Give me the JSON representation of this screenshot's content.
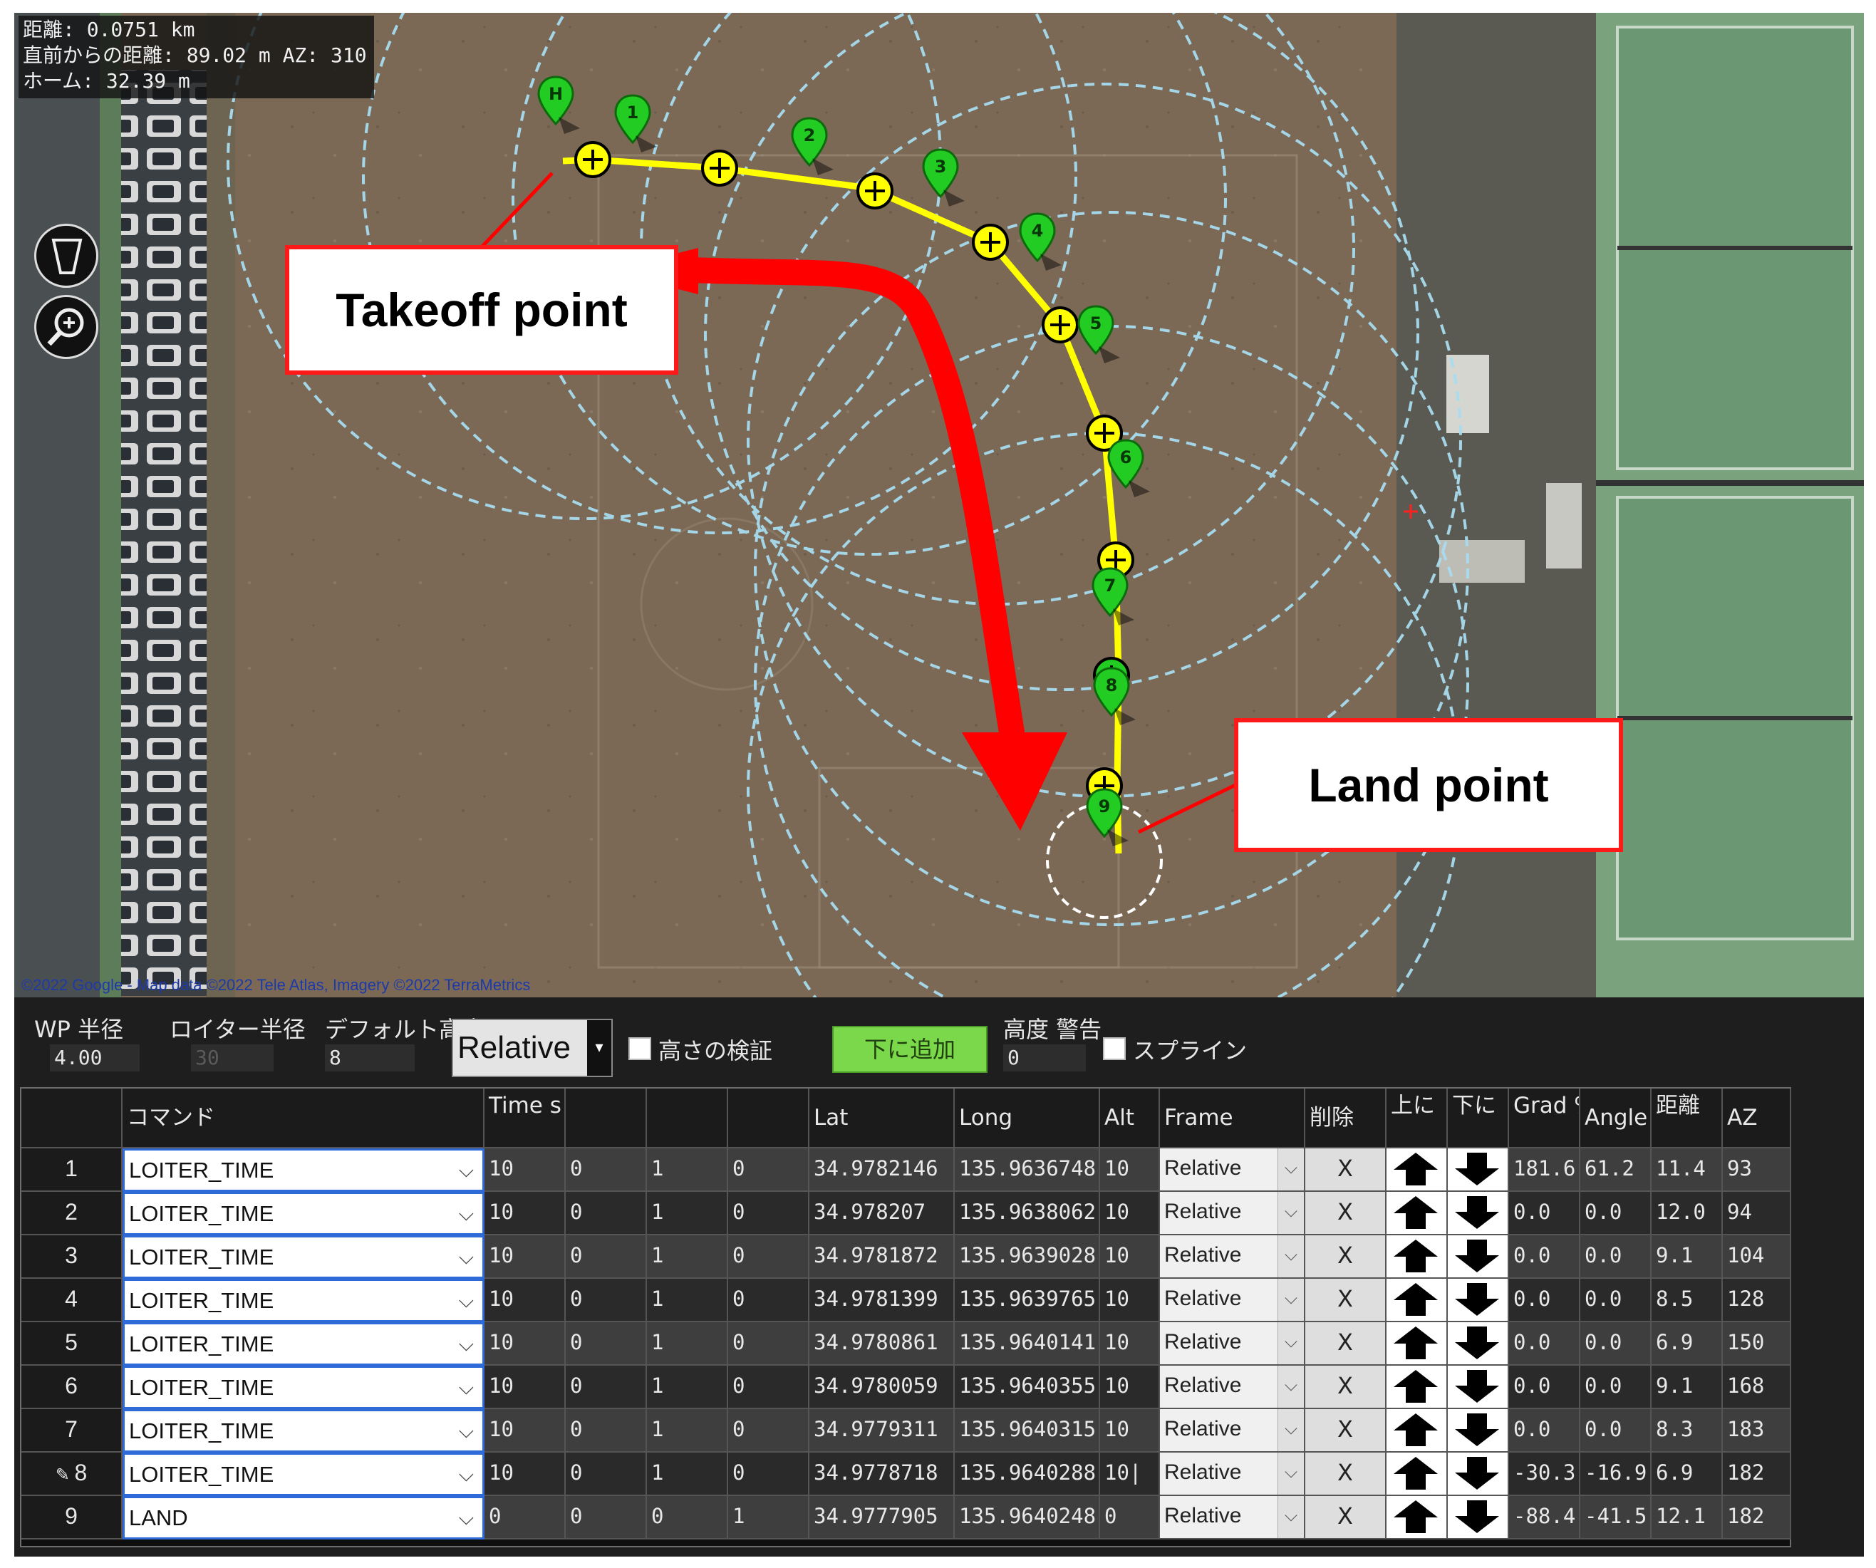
{
  "map": {
    "info": {
      "distance": "距離: 0.0751 km",
      "from_prev": "直前からの距離: 89.02 m AZ: 310",
      "home": "ホーム: 32.39 m"
    },
    "attribution": "©2022 Google - Map data ©2022 Tele Atlas, Imagery ©2022 TerraMetrics",
    "markers": [
      "H",
      "1",
      "2",
      "3",
      "4",
      "5",
      "6",
      "7",
      "8",
      "9"
    ],
    "tools": [
      "ruler-icon",
      "zoom-icon"
    ]
  },
  "callouts": {
    "takeoff": "Takeoff point",
    "land": "Land point"
  },
  "controls": {
    "wp_radius_label": "WP 半径",
    "wp_radius_value": "4.00",
    "loiter_radius_label": "ロイター半径",
    "loiter_radius_value": "30",
    "default_alt_label": "デフォルト高度",
    "default_alt_value": "8",
    "alt_frame_value": "Relative",
    "verify_height_label": "高さの検証",
    "add_below_label": "下に追加",
    "alt_warn_label": "高度 警告",
    "alt_warn_value": "0",
    "spline_label": "スプライン"
  },
  "table": {
    "headers": {
      "command": "コマンド",
      "time": "Time s",
      "p2": "",
      "p3": "",
      "p4": "",
      "lat": "Lat",
      "long": "Long",
      "alt": "Alt",
      "frame": "Frame",
      "delete": "削除",
      "up": "上に",
      "down": "下に",
      "grad": "Grad %",
      "angle": "Angle",
      "dist": "距離",
      "az": "AZ"
    },
    "rows": [
      {
        "n": "1",
        "cmd": "LOITER_TIME",
        "time": "10",
        "p2": "0",
        "p3": "1",
        "p4": "0",
        "lat": "34.9782146",
        "lon": "135.9636748",
        "alt": "10",
        "frame": "Relative",
        "del": "X",
        "grad": "181.6",
        "angle": "61.2",
        "dist": "11.4",
        "az": "93"
      },
      {
        "n": "2",
        "cmd": "LOITER_TIME",
        "time": "10",
        "p2": "0",
        "p3": "1",
        "p4": "0",
        "lat": "34.978207",
        "lon": "135.9638062",
        "alt": "10",
        "frame": "Relative",
        "del": "X",
        "grad": "0.0",
        "angle": "0.0",
        "dist": "12.0",
        "az": "94"
      },
      {
        "n": "3",
        "cmd": "LOITER_TIME",
        "time": "10",
        "p2": "0",
        "p3": "1",
        "p4": "0",
        "lat": "34.9781872",
        "lon": "135.9639028",
        "alt": "10",
        "frame": "Relative",
        "del": "X",
        "grad": "0.0",
        "angle": "0.0",
        "dist": "9.1",
        "az": "104"
      },
      {
        "n": "4",
        "cmd": "LOITER_TIME",
        "time": "10",
        "p2": "0",
        "p3": "1",
        "p4": "0",
        "lat": "34.9781399",
        "lon": "135.9639765",
        "alt": "10",
        "frame": "Relative",
        "del": "X",
        "grad": "0.0",
        "angle": "0.0",
        "dist": "8.5",
        "az": "128"
      },
      {
        "n": "5",
        "cmd": "LOITER_TIME",
        "time": "10",
        "p2": "0",
        "p3": "1",
        "p4": "0",
        "lat": "34.9780861",
        "lon": "135.9640141",
        "alt": "10",
        "frame": "Relative",
        "del": "X",
        "grad": "0.0",
        "angle": "0.0",
        "dist": "6.9",
        "az": "150"
      },
      {
        "n": "6",
        "cmd": "LOITER_TIME",
        "time": "10",
        "p2": "0",
        "p3": "1",
        "p4": "0",
        "lat": "34.9780059",
        "lon": "135.9640355",
        "alt": "10",
        "frame": "Relative",
        "del": "X",
        "grad": "0.0",
        "angle": "0.0",
        "dist": "9.1",
        "az": "168"
      },
      {
        "n": "7",
        "cmd": "LOITER_TIME",
        "time": "10",
        "p2": "0",
        "p3": "1",
        "p4": "0",
        "lat": "34.9779311",
        "lon": "135.9640315",
        "alt": "10",
        "frame": "Relative",
        "del": "X",
        "grad": "0.0",
        "angle": "0.0",
        "dist": "8.3",
        "az": "183"
      },
      {
        "n": "8",
        "cmd": "LOITER_TIME",
        "time": "10",
        "p2": "0",
        "p3": "1",
        "p4": "0",
        "lat": "34.9778718",
        "lon": "135.9640288",
        "alt": "10|",
        "frame": "Relative",
        "del": "X",
        "grad": "-30.3",
        "angle": "-16.9",
        "dist": "6.9",
        "az": "182"
      },
      {
        "n": "9",
        "cmd": "LAND",
        "time": "0",
        "p2": "0",
        "p3": "0",
        "p4": "1",
        "lat": "34.9777905",
        "lon": "135.9640248",
        "alt": "0",
        "frame": "Relative",
        "del": "X",
        "grad": "-88.4",
        "angle": "-41.5",
        "dist": "12.1",
        "az": "182"
      }
    ]
  },
  "colors": {
    "callout_border": "#ff1a1a",
    "route": "#ffff00",
    "marker": "#22cc22",
    "radius_circles": "#a8dcf0",
    "add_button": "#7bd84a",
    "command_border": "#2e6bd9"
  }
}
